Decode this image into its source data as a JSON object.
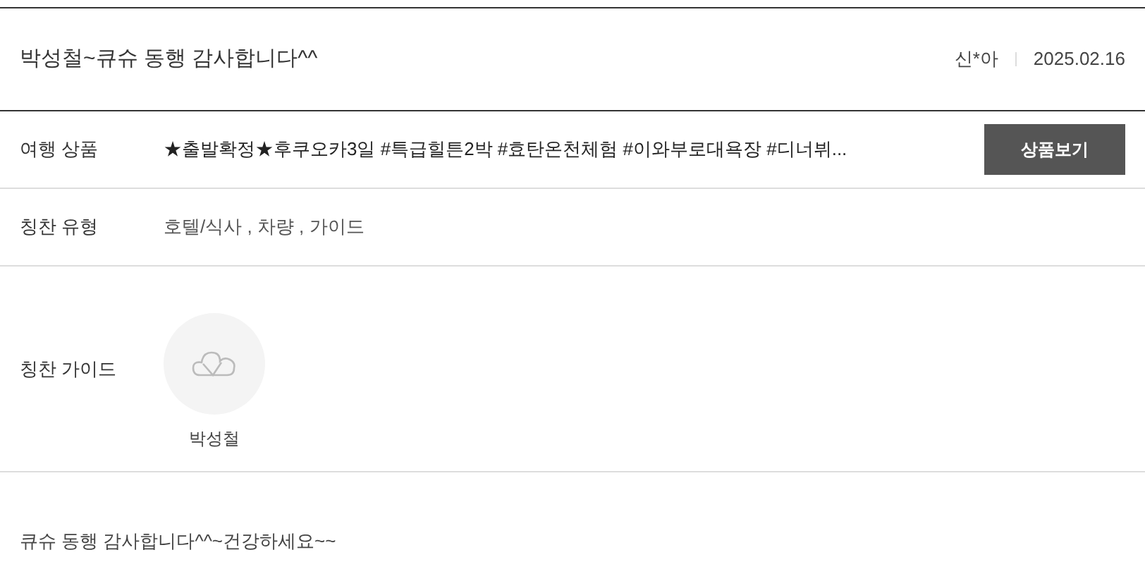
{
  "post": {
    "title": "박성철~큐슈 동행 감사합니다^^",
    "author": "신*아",
    "date": "2025.02.16"
  },
  "rows": [
    {
      "kind": "product",
      "label": "여행 상품",
      "value": "★출발확정★후쿠오카3일 #특급힐튼2박 #효탄온천체험 #이와부로대욕장 #디너뷔...",
      "button": "상품보기"
    },
    {
      "kind": "text",
      "label": "칭찬 유형",
      "value": "호텔/식사 , 차량 , 가이드"
    },
    {
      "kind": "guide",
      "label": "칭찬 가이드",
      "guides": [
        {
          "name": "박성철"
        }
      ]
    }
  ],
  "body": "큐슈 동행 감사합니다^^~건강하세요~~"
}
